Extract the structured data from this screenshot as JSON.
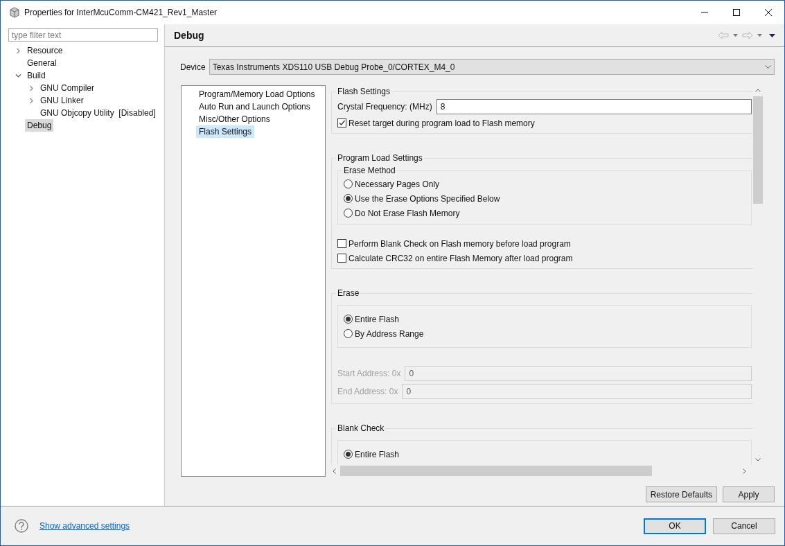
{
  "window": {
    "title": "Properties for InterMcuComm-CM421_Rev1_Master"
  },
  "filter": {
    "placeholder": "type filter text"
  },
  "tree": [
    {
      "label": "Resource",
      "expanded": false,
      "selected": false
    },
    {
      "label": "General",
      "selected": false
    },
    {
      "label": "Build",
      "expanded": true,
      "selected": false,
      "children": [
        {
          "label": "GNU Compiler",
          "expanded": false,
          "selected": false
        },
        {
          "label": "GNU Linker",
          "expanded": false,
          "selected": false
        },
        {
          "label": "GNU Objcopy Utility  [Disabled]",
          "selected": false
        }
      ]
    },
    {
      "label": "Debug",
      "selected": true
    }
  ],
  "page": {
    "title": "Debug"
  },
  "device": {
    "label": "Device",
    "value": "Texas Instruments XDS110 USB Debug Probe_0/CORTEX_M4_0"
  },
  "categories": [
    {
      "label": "Program/Memory Load Options",
      "selected": false
    },
    {
      "label": "Auto Run and Launch Options",
      "selected": false
    },
    {
      "label": "Misc/Other Options",
      "selected": false
    },
    {
      "label": "Flash Settings",
      "selected": true
    }
  ],
  "sections": [
    {
      "title": "Flash Settings",
      "items": [
        {
          "kind": "field",
          "label": "Crystal Frequency: (MHz)",
          "value": "8",
          "disabled": false
        },
        {
          "kind": "checkbox",
          "label": "Reset target during program load to Flash memory",
          "checked": true
        }
      ]
    },
    {
      "title": "Program Load Settings",
      "items": [
        {
          "kind": "radio_group",
          "title": "Erase Method",
          "options": [
            {
              "label": "Necessary Pages Only",
              "selected": false
            },
            {
              "label": "Use the Erase Options Specified Below",
              "selected": true
            },
            {
              "label": "Do Not Erase Flash Memory",
              "selected": false
            }
          ]
        },
        {
          "kind": "checkbox",
          "label": "Perform Blank Check on Flash memory before load program",
          "checked": false
        },
        {
          "kind": "checkbox",
          "label": "Calculate CRC32 on entire Flash Memory after load program",
          "checked": false
        }
      ]
    },
    {
      "title": "Erase",
      "items": [
        {
          "kind": "radio_group",
          "options": [
            {
              "label": "Entire Flash",
              "selected": true
            },
            {
              "label": "By Address Range",
              "selected": false
            }
          ]
        },
        {
          "kind": "field",
          "label": "Start Address: 0x",
          "value": "0",
          "disabled": true
        },
        {
          "kind": "field",
          "label": "End Address: 0x",
          "value": "0",
          "disabled": true
        }
      ]
    },
    {
      "title": "Blank Check",
      "items": [
        {
          "kind": "radio_group",
          "options": [
            {
              "label": "Entire Flash",
              "selected": true
            }
          ]
        }
      ]
    }
  ],
  "page_buttons": [
    "Restore Defaults",
    "Apply"
  ],
  "footer": {
    "link": "Show advanced settings",
    "buttons": [
      {
        "label": "OK",
        "default": true
      },
      {
        "label": "Cancel",
        "default": false
      }
    ]
  }
}
